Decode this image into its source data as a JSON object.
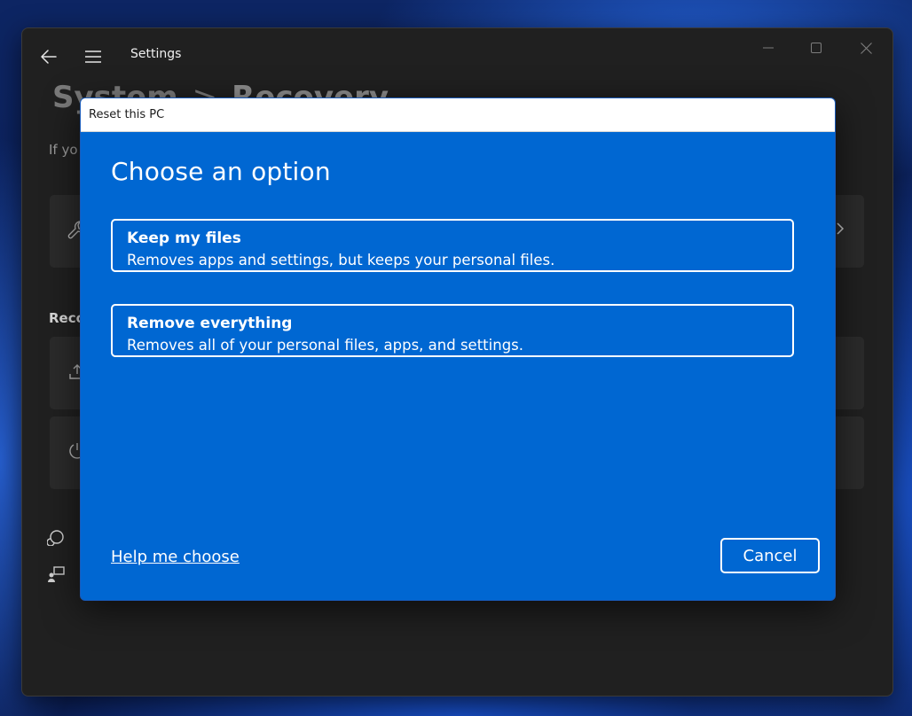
{
  "settings_window": {
    "app_title": "Settings",
    "breadcrumb": {
      "parent": "System",
      "separator": ">",
      "current": "Recovery"
    },
    "description_fragment": "If yo",
    "section_fragment": "Reco",
    "icons": {
      "back": "back-arrow-icon",
      "menu": "hamburger-menu-icon",
      "minimize": "minimize-icon",
      "maximize": "maximize-icon",
      "close": "close-icon"
    }
  },
  "dialog": {
    "title": "Reset this PC",
    "heading": "Choose an option",
    "options": [
      {
        "title": "Keep my files",
        "description": "Removes apps and settings, but keeps your personal files."
      },
      {
        "title": "Remove everything",
        "description": "Removes all of your personal files, apps, and settings."
      }
    ],
    "help_link": "Help me choose",
    "cancel_label": "Cancel",
    "colors": {
      "background": "#0067d2",
      "text": "#ffffff",
      "titlebar": "#ffffff"
    }
  },
  "colors": {
    "window_bg": "#202020",
    "card_bg": "#2b2b2b"
  }
}
